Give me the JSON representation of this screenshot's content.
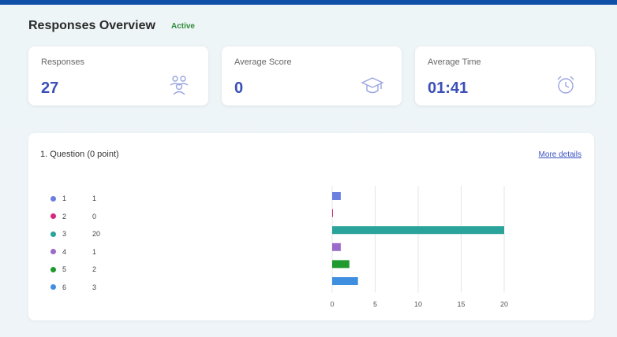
{
  "header": {
    "title": "Responses Overview",
    "status": "Active"
  },
  "cards": [
    {
      "label": "Responses",
      "value": "27",
      "icon": "people-icon"
    },
    {
      "label": "Average Score",
      "value": "0",
      "icon": "graduation-cap-icon"
    },
    {
      "label": "Average Time",
      "value": "01:41",
      "icon": "alarm-clock-icon"
    }
  ],
  "question": {
    "title": "1. Question (0 point)",
    "more_details": "More details"
  },
  "legend": [
    {
      "option": "1",
      "count": "1"
    },
    {
      "option": "2",
      "count": "0"
    },
    {
      "option": "3",
      "count": "20"
    },
    {
      "option": "4",
      "count": "1"
    },
    {
      "option": "5",
      "count": "2"
    },
    {
      "option": "6",
      "count": "3"
    }
  ],
  "colors": {
    "accent": "#3b4fb8",
    "options": [
      "#6b7fe0",
      "#d6287c",
      "#2aa39b",
      "#9a6bc9",
      "#1f9a2e",
      "#3f8fe0"
    ]
  },
  "chart_data": {
    "type": "bar",
    "orientation": "horizontal",
    "categories": [
      "1",
      "2",
      "3",
      "4",
      "5",
      "6"
    ],
    "values": [
      1,
      0,
      20,
      1,
      2,
      3
    ],
    "xlim": [
      0,
      20
    ],
    "xticks": [
      "0",
      "5",
      "10",
      "15",
      "20"
    ],
    "grid": true,
    "title": "",
    "xlabel": "",
    "ylabel": ""
  }
}
